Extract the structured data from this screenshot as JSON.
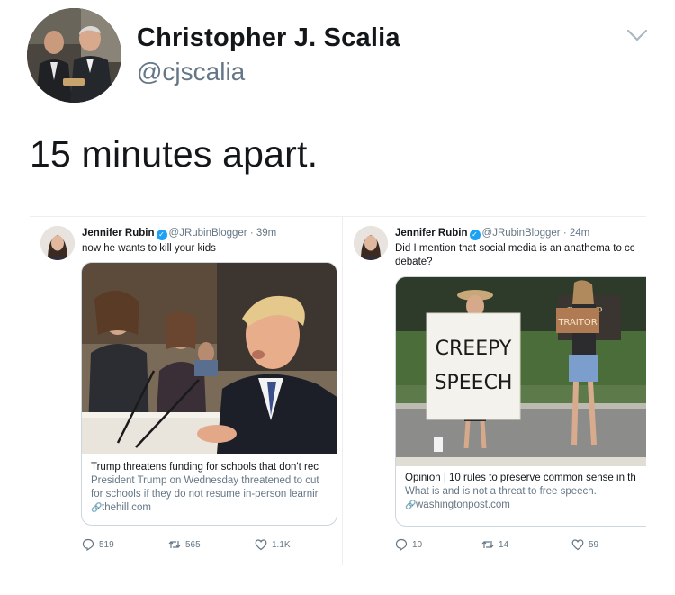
{
  "author": {
    "name": "Christopher J. Scalia",
    "handle": "@cjscalia"
  },
  "tweet_text": "15 minutes apart.",
  "embeds": [
    {
      "author_name": "Jennifer Rubin",
      "author_handle": "@JRubinBlogger · 39m",
      "text_lines": [
        "now he wants to kill your kids"
      ],
      "card": {
        "title": "Trump threatens funding for schools that don't rec",
        "description_lines": [
          "President Trump on Wednesday threatened to cut",
          "for schools if they do not resume in-person learnir"
        ],
        "domain": "thehill.com"
      },
      "stats": {
        "replies": "519",
        "retweets": "565",
        "likes": "1.1K"
      }
    },
    {
      "author_name": "Jennifer Rubin",
      "author_handle": "@JRubinBlogger · 24m",
      "text_lines": [
        "Did I mention that social media is an anathema to cc",
        "debate?"
      ],
      "card": {
        "title": "Opinion | 10 rules to preserve common sense in th",
        "description_lines": [
          "What is and is not a threat to free speech."
        ],
        "domain": "washingtonpost.com",
        "sign_main_lines": [
          "CREEPY",
          "SPEECH"
        ],
        "sign_side": "TRAITOR",
        "sign_banner": "RUMP"
      },
      "stats": {
        "replies": "10",
        "retweets": "14",
        "likes": "59"
      }
    }
  ],
  "icons": [
    "chevron-down-icon",
    "verified-icon",
    "link-icon",
    "reply-icon",
    "retweet-icon",
    "like-icon"
  ],
  "colors": {
    "text": "#14171a",
    "secondary": "#657786",
    "verified": "#1da1f2",
    "border": "#ccd6dd"
  }
}
